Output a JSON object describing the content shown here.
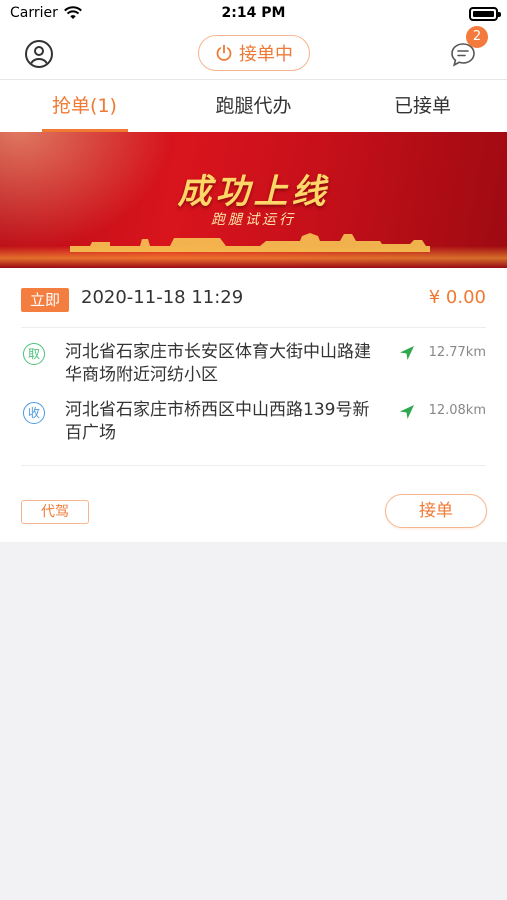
{
  "status_bar": {
    "carrier": "Carrier",
    "time": "2:14 PM"
  },
  "header": {
    "status_label": "接单中",
    "message_count": "2"
  },
  "tabs": [
    {
      "label": "抢单(1)",
      "active": true
    },
    {
      "label": "跑腿代办",
      "active": false
    },
    {
      "label": "已接单",
      "active": false
    }
  ],
  "banner": {
    "title": "成功上线",
    "subtitle": "跑腿试运行"
  },
  "order": {
    "timing_tag": "立即",
    "time": "2020-11-18 11:29",
    "price": "¥ 0.00",
    "pickup": {
      "badge": "取",
      "address": "河北省石家庄市长安区体育大街中山路建华商场附近河纺小区",
      "distance": "12.77km"
    },
    "dropoff": {
      "badge": "收",
      "address": "河北省石家庄市桥西区中山西路139号新百广场",
      "distance": "12.08km"
    },
    "service_type": "代驾",
    "accept_label": "接单"
  },
  "colors": {
    "accent": "#f07a33",
    "pickup": "#4cc27a",
    "dropoff": "#4a9be0",
    "banner_red": "#d9141d"
  },
  "icons": [
    "wifi-icon",
    "battery-icon",
    "user-icon",
    "power-icon",
    "message-icon",
    "navigation-arrow-icon"
  ]
}
